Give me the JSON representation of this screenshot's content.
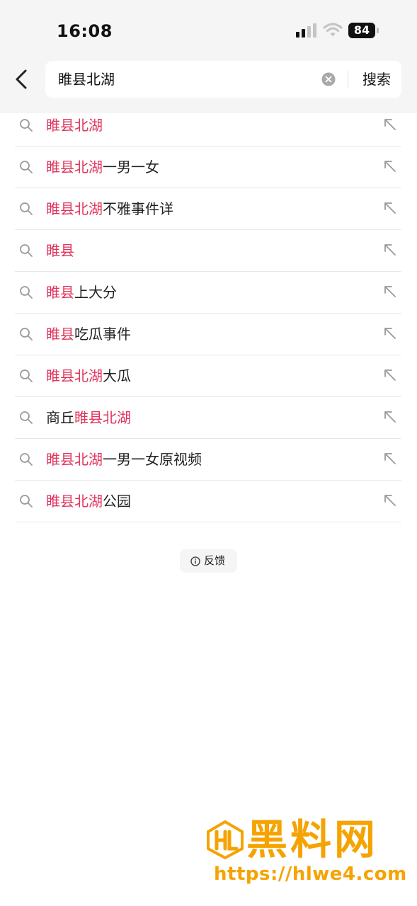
{
  "status_bar": {
    "time": "16:08",
    "battery": "84"
  },
  "search": {
    "query": "睢县北湖",
    "submit_label": "搜索"
  },
  "suggestions": [
    {
      "pre": "",
      "hl": "睢县北湖",
      "post": ""
    },
    {
      "pre": "",
      "hl": "睢县北湖",
      "post": "一男一女"
    },
    {
      "pre": "",
      "hl": "睢县北湖",
      "post": "不雅事件详"
    },
    {
      "pre": "",
      "hl": "睢县",
      "post": ""
    },
    {
      "pre": "",
      "hl": "睢县",
      "post": "上大分"
    },
    {
      "pre": "",
      "hl": "睢县",
      "post": "吃瓜事件"
    },
    {
      "pre": "",
      "hl": "睢县北湖",
      "post": "大瓜"
    },
    {
      "pre": "商丘",
      "hl": "睢县北湖",
      "post": ""
    },
    {
      "pre": "",
      "hl": "睢县北湖",
      "post": "一男一女原视频"
    },
    {
      "pre": "",
      "hl": "睢县北湖",
      "post": "公园"
    }
  ],
  "feedback": {
    "label": "反馈"
  },
  "watermark": {
    "title": "黑料网",
    "url": "https://hlwe4.com"
  },
  "colors": {
    "highlight": "#e0345c",
    "watermark": "#f5a300",
    "header_bg": "#f5f5f5"
  },
  "icons": {
    "back": "chevron-left-icon",
    "clear": "clear-circle-icon",
    "suggestion": "search-icon",
    "fill_query": "arrow-up-left-icon",
    "feedback": "info-icon"
  }
}
